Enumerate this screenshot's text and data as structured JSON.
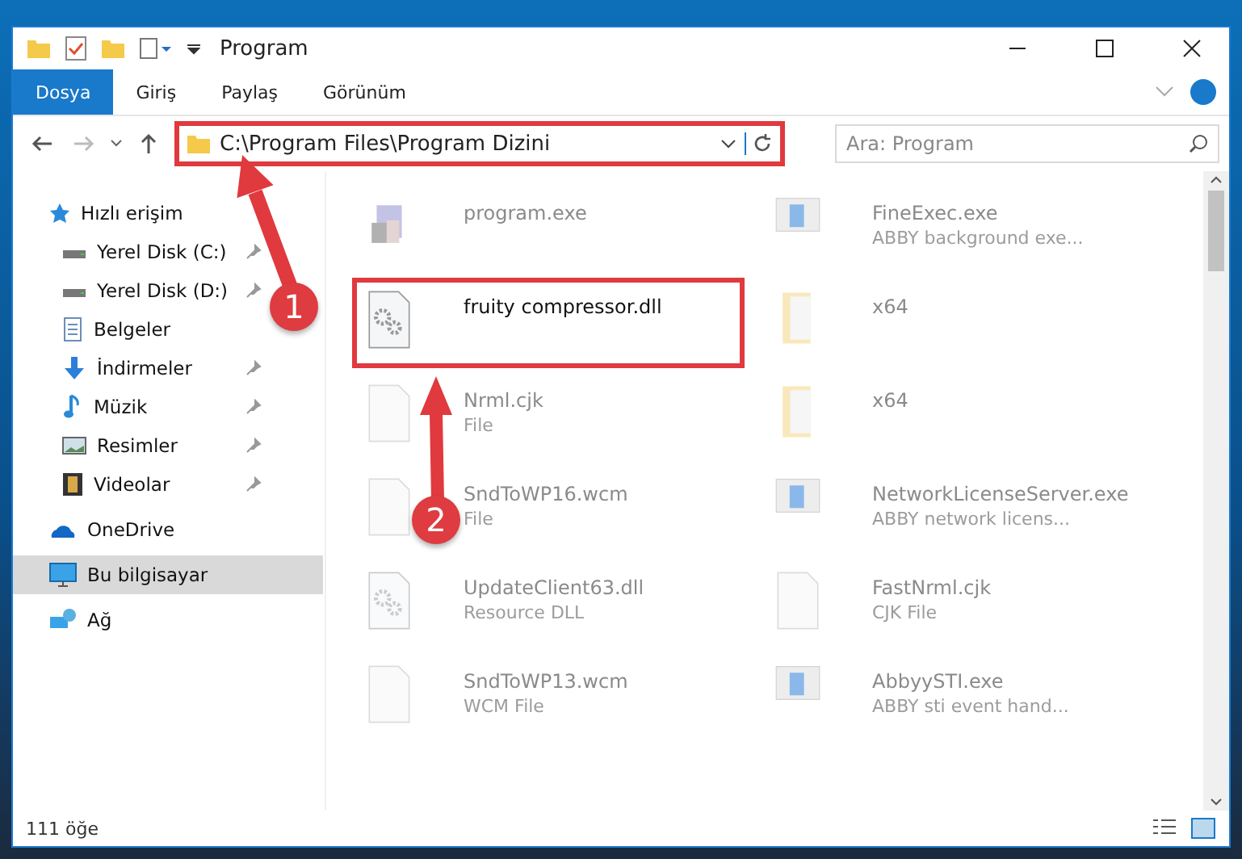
{
  "window": {
    "title": "Program"
  },
  "ribbon_tabs": [
    {
      "label": "Dosya",
      "selected": true
    },
    {
      "label": "Giriş",
      "selected": false
    },
    {
      "label": "Paylaş",
      "selected": false
    },
    {
      "label": "Görünüm",
      "selected": false
    }
  ],
  "address_bar": {
    "path": "C:\\Program Files\\Program Dizini",
    "highlighted": true
  },
  "search": {
    "placeholder": "Ara: Program"
  },
  "sidebar": {
    "items": [
      {
        "label": "Hızlı erişim",
        "kind": "quick",
        "selected": false,
        "pinned": false,
        "children": [
          {
            "label": "Yerel Disk (C:)",
            "kind": "disk",
            "selected": false,
            "pinned": true
          },
          {
            "label": "Yerel Disk (D:)",
            "kind": "disk",
            "selected": false,
            "pinned": true
          },
          {
            "label": "Belgeler",
            "kind": "docs",
            "selected": false,
            "pinned": false
          },
          {
            "label": "İndirmeler",
            "kind": "download",
            "selected": false,
            "pinned": true
          },
          {
            "label": "Müzik",
            "kind": "music",
            "selected": false,
            "pinned": true
          },
          {
            "label": "Resimler",
            "kind": "pictures",
            "selected": false,
            "pinned": true
          },
          {
            "label": "Videolar",
            "kind": "video",
            "selected": false,
            "pinned": true
          }
        ]
      },
      {
        "label": "OneDrive",
        "kind": "cloud",
        "selected": false,
        "pinned": false
      },
      {
        "label": "Bu bilgisayar",
        "kind": "pc",
        "selected": true,
        "pinned": false
      },
      {
        "label": "Ağ",
        "kind": "network",
        "selected": false,
        "pinned": false
      }
    ]
  },
  "files": [
    {
      "name": "program.exe",
      "kind": "installer",
      "highlighted": false
    },
    {
      "name": "FineExec.exe",
      "type": "ABBY background exe...",
      "kind": "app",
      "highlighted": false
    },
    {
      "name": "fruity compressor.dll",
      "kind": "dll",
      "highlighted": true
    },
    {
      "name": "x64",
      "kind": "folder",
      "highlighted": false
    },
    {
      "name": "Nrml.cjk",
      "type": "File",
      "kind": "blank",
      "highlighted": false
    },
    {
      "name": "x64",
      "kind": "folder",
      "highlighted": false
    },
    {
      "name": "SndToWP16.wcm",
      "type": "File",
      "kind": "blank",
      "highlighted": false
    },
    {
      "name": "NetworkLicenseServer.exe",
      "type": "ABBY network licens...",
      "kind": "app",
      "highlighted": false
    },
    {
      "name": "UpdateClient63.dll",
      "type": "Resource DLL",
      "kind": "dll",
      "highlighted": false
    },
    {
      "name": "FastNrml.cjk",
      "type": "CJK File",
      "kind": "blank",
      "highlighted": false
    },
    {
      "name": "SndToWP13.wcm",
      "type": "WCM File",
      "kind": "blank",
      "highlighted": false
    },
    {
      "name": "AbbyySTI.exe",
      "type": "ABBY sti event hand...",
      "kind": "app",
      "highlighted": false
    }
  ],
  "status_bar": {
    "count": "111 öğe"
  },
  "annotations": [
    {
      "number": "1"
    },
    {
      "number": "2"
    }
  ]
}
